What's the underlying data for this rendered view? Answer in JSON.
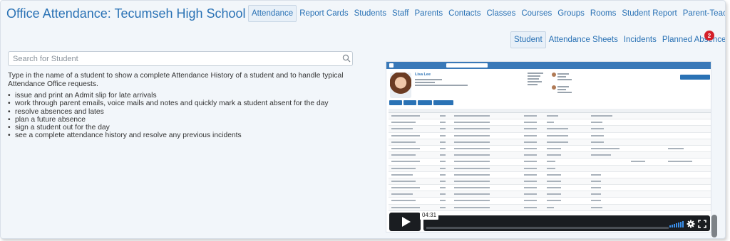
{
  "header": {
    "title": "Office Attendance: Tecumseh High School"
  },
  "top_nav": {
    "tabs": [
      {
        "label": "Attendance",
        "active": true
      },
      {
        "label": "Report Cards"
      },
      {
        "label": "Students"
      },
      {
        "label": "Staff"
      },
      {
        "label": "Parents"
      },
      {
        "label": "Contacts"
      },
      {
        "label": "Classes"
      },
      {
        "label": "Courses"
      },
      {
        "label": "Groups"
      },
      {
        "label": "Rooms"
      },
      {
        "label": "Student Report"
      },
      {
        "label": "Parent-Teacher Interviews"
      }
    ]
  },
  "sub_nav": {
    "tabs": [
      {
        "label": "Student",
        "active": true
      },
      {
        "label": "Attendance Sheets"
      },
      {
        "label": "Incidents"
      },
      {
        "label": "Planned Absences"
      }
    ],
    "badge_count": "2",
    "badge_color": "#d4202a"
  },
  "search": {
    "placeholder": "Search for Student",
    "value": ""
  },
  "intro": {
    "text": "Type in the name of a student to show a complete Attendance History of a student and to handle typical Attendance Office requests.",
    "bullets": [
      "issue and print an Admit slip for late arrivals",
      "work through parent emails, voice mails and notes and quickly mark a student absent for the day",
      "resolve absences and lates",
      "plan a future absence",
      "sign a student out for the day",
      "see a complete attendance history and resolve any previous incidents"
    ]
  },
  "video": {
    "student_name": "Lisa Lee",
    "timecode": "04:31",
    "progress": 0,
    "accent_color": "#2a72b5"
  },
  "colors": {
    "link": "#2a72b5",
    "background": "#f2f6fa"
  }
}
